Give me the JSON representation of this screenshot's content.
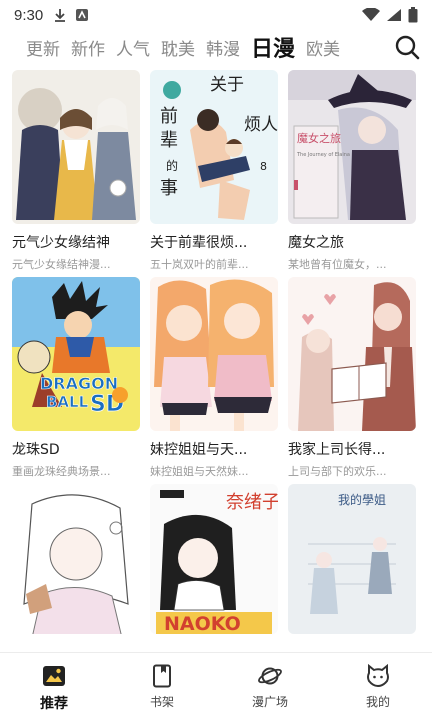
{
  "status_bar": {
    "time": "9:30"
  },
  "tabs": [
    {
      "label": "更新"
    },
    {
      "label": "新作"
    },
    {
      "label": "人气"
    },
    {
      "label": "耽美"
    },
    {
      "label": "韩漫"
    },
    {
      "label": "日漫"
    },
    {
      "label": "欧美"
    }
  ],
  "active_tab": "日漫",
  "comics": [
    {
      "title": "元气少女缘结神",
      "desc": "元气少女缘结神漫..."
    },
    {
      "title": "关于前辈很烦...",
      "desc": "五十岚双叶的前辈..."
    },
    {
      "title": "魔女之旅",
      "desc": "某地曾有位魔女，..."
    },
    {
      "title": "龙珠SD",
      "desc": "重画龙珠经典场景..."
    },
    {
      "title": "妹控姐姐与天...",
      "desc": "妹控姐姐与天然妹..."
    },
    {
      "title": "我家上司长得...",
      "desc": "上司与部下的欢乐..."
    }
  ],
  "covers": {
    "c2_line1": "关于",
    "c2_line2": "前",
    "c2_line3": "辈",
    "c2_line4": "的",
    "c2_line5": "事",
    "c2_big": "烦人",
    "c2_vol": "8",
    "c3_title": "魔女之旅",
    "c3_sub": "The Journey of Elaina",
    "c4_logo1": "DRAGON",
    "c4_logo2": "BALL",
    "c4_logo3": "SD",
    "c8_title": "奈绪子",
    "c8_logo": "NAOKO",
    "c9_title": "我的學姐"
  },
  "bottom_nav": [
    {
      "label": "推荐",
      "icon": "recommend-icon"
    },
    {
      "label": "书架",
      "icon": "bookshelf-icon"
    },
    {
      "label": "漫广场",
      "icon": "planet-icon"
    },
    {
      "label": "我的",
      "icon": "profile-icon"
    }
  ],
  "colors": {
    "active_text": "#111111",
    "inactive_tab": "#8a8a8a",
    "desc_text": "#999999"
  }
}
